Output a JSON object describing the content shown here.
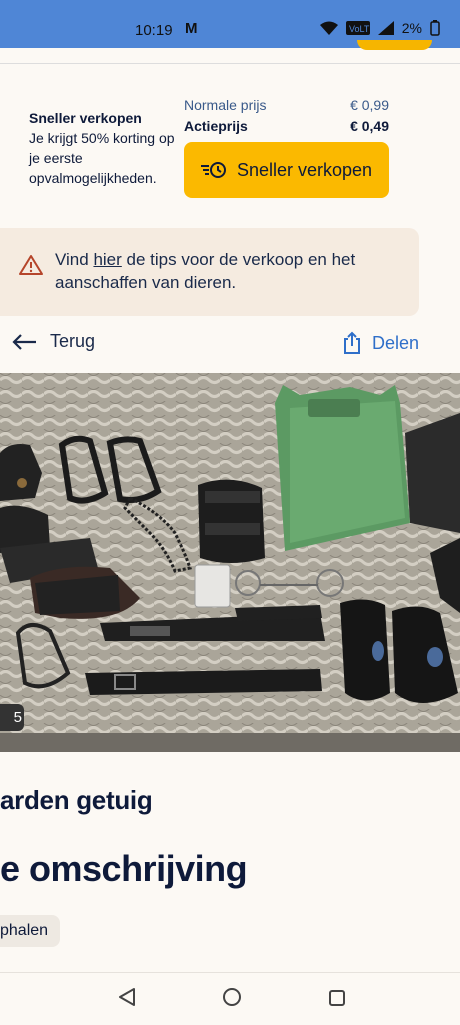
{
  "status": {
    "time": "10:19",
    "mail_icon": "M",
    "battery": "2%"
  },
  "promo": {
    "title": "Sneller verkopen",
    "body": "Je krijgt 50% korting op je eerste opvalmogelijkheden.",
    "normal_label": "Normale prijs",
    "normal_price": "€ 0,99",
    "action_label": "Actieprijs",
    "action_price": "€ 0,49",
    "button": "Sneller verkopen"
  },
  "tips": {
    "pre": "Vind ",
    "link": "hier",
    "post": " de tips voor de verkoop en het aanschaffen van dieren."
  },
  "nav": {
    "back": "Terug",
    "share": "Delen"
  },
  "photo": {
    "counter": "5"
  },
  "listing": {
    "title": "arden getuig",
    "section": "e omschrijving",
    "chip": "phalen"
  }
}
